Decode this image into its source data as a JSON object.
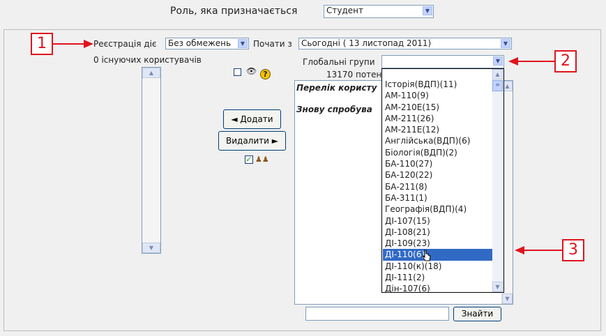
{
  "role": {
    "label": "Роль, яка призначається",
    "value": "Студент"
  },
  "enrol": {
    "duration_label": "Реєстрація діє",
    "duration_value": "Без обмежень",
    "start_label": "Почати з",
    "start_value": "Сьогодні ( 13 листопад 2011)"
  },
  "existing": {
    "label": "0 існуючих користувачів"
  },
  "groups": {
    "label": "Глобальні групи",
    "value": ""
  },
  "potential": {
    "count_label": "13170 потен",
    "list_heading": "Перелік користу",
    "retry_text": "Знову спробува"
  },
  "buttons": {
    "add": "◄ Додати",
    "remove": "Видалити ►",
    "search": "Знайти"
  },
  "search": {
    "value": ""
  },
  "callouts": [
    "1",
    "2",
    "3"
  ],
  "dropdown_options": [
    "Історія(ВДП)(11)",
    "АМ-110(9)",
    "АМ-210Е(15)",
    "АМ-211(26)",
    "АМ-211Е(12)",
    "Англійська(ВДП)(6)",
    "Біологія(ВДП)(2)",
    "БА-110(27)",
    "БА-120(22)",
    "БА-211(8)",
    "БА-311(1)",
    "Географія(ВДП)(4)",
    "ДІ-107(15)",
    "ДІ-108(21)",
    "ДІ-109(23)",
    "ДІ-110(6)",
    "ДІ-110(к)(18)",
    "ДІ-111(2)",
    "Дін-107(6)"
  ],
  "highlighted_option": "ДІ-110(6)",
  "colors": {
    "callout": "#e0141e",
    "highlight": "#316ac5"
  },
  "icons": [
    "eye-icon",
    "help-icon",
    "group-icon"
  ]
}
